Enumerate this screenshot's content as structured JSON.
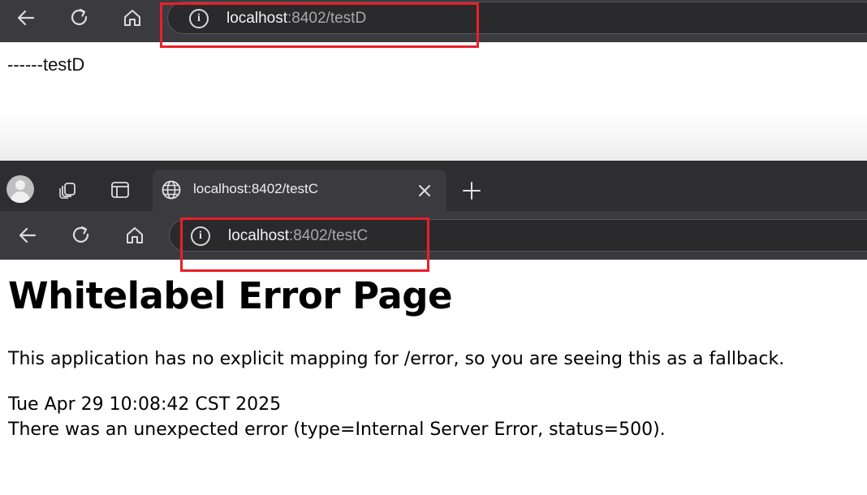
{
  "window_d": {
    "url_host": "localhost",
    "url_rest": ":8402/testD",
    "body_text": "------testD"
  },
  "window_c": {
    "tab_title": "localhost:8402/testC",
    "url_host": "localhost",
    "url_rest": ":8402/testC",
    "heading": "Whitelabel Error Page",
    "message": "This application has no explicit mapping for /error, so you are seeing this as a fallback.",
    "timestamp": "Tue Apr 29 10:08:42 CST 2025",
    "error_detail": "There was an unexpected error (type=Internal Server Error, status=500)."
  },
  "icons": [
    "back-arrow-icon",
    "refresh-icon",
    "home-icon",
    "info-icon",
    "profile-avatar-icon",
    "workspaces-icon",
    "tab-actions-icon",
    "globe-icon",
    "close-icon",
    "plus-icon"
  ],
  "colors": {
    "highlight": "#e8202a",
    "toolbar": "#3b3b3f",
    "tabstrip": "#2e2e31"
  }
}
